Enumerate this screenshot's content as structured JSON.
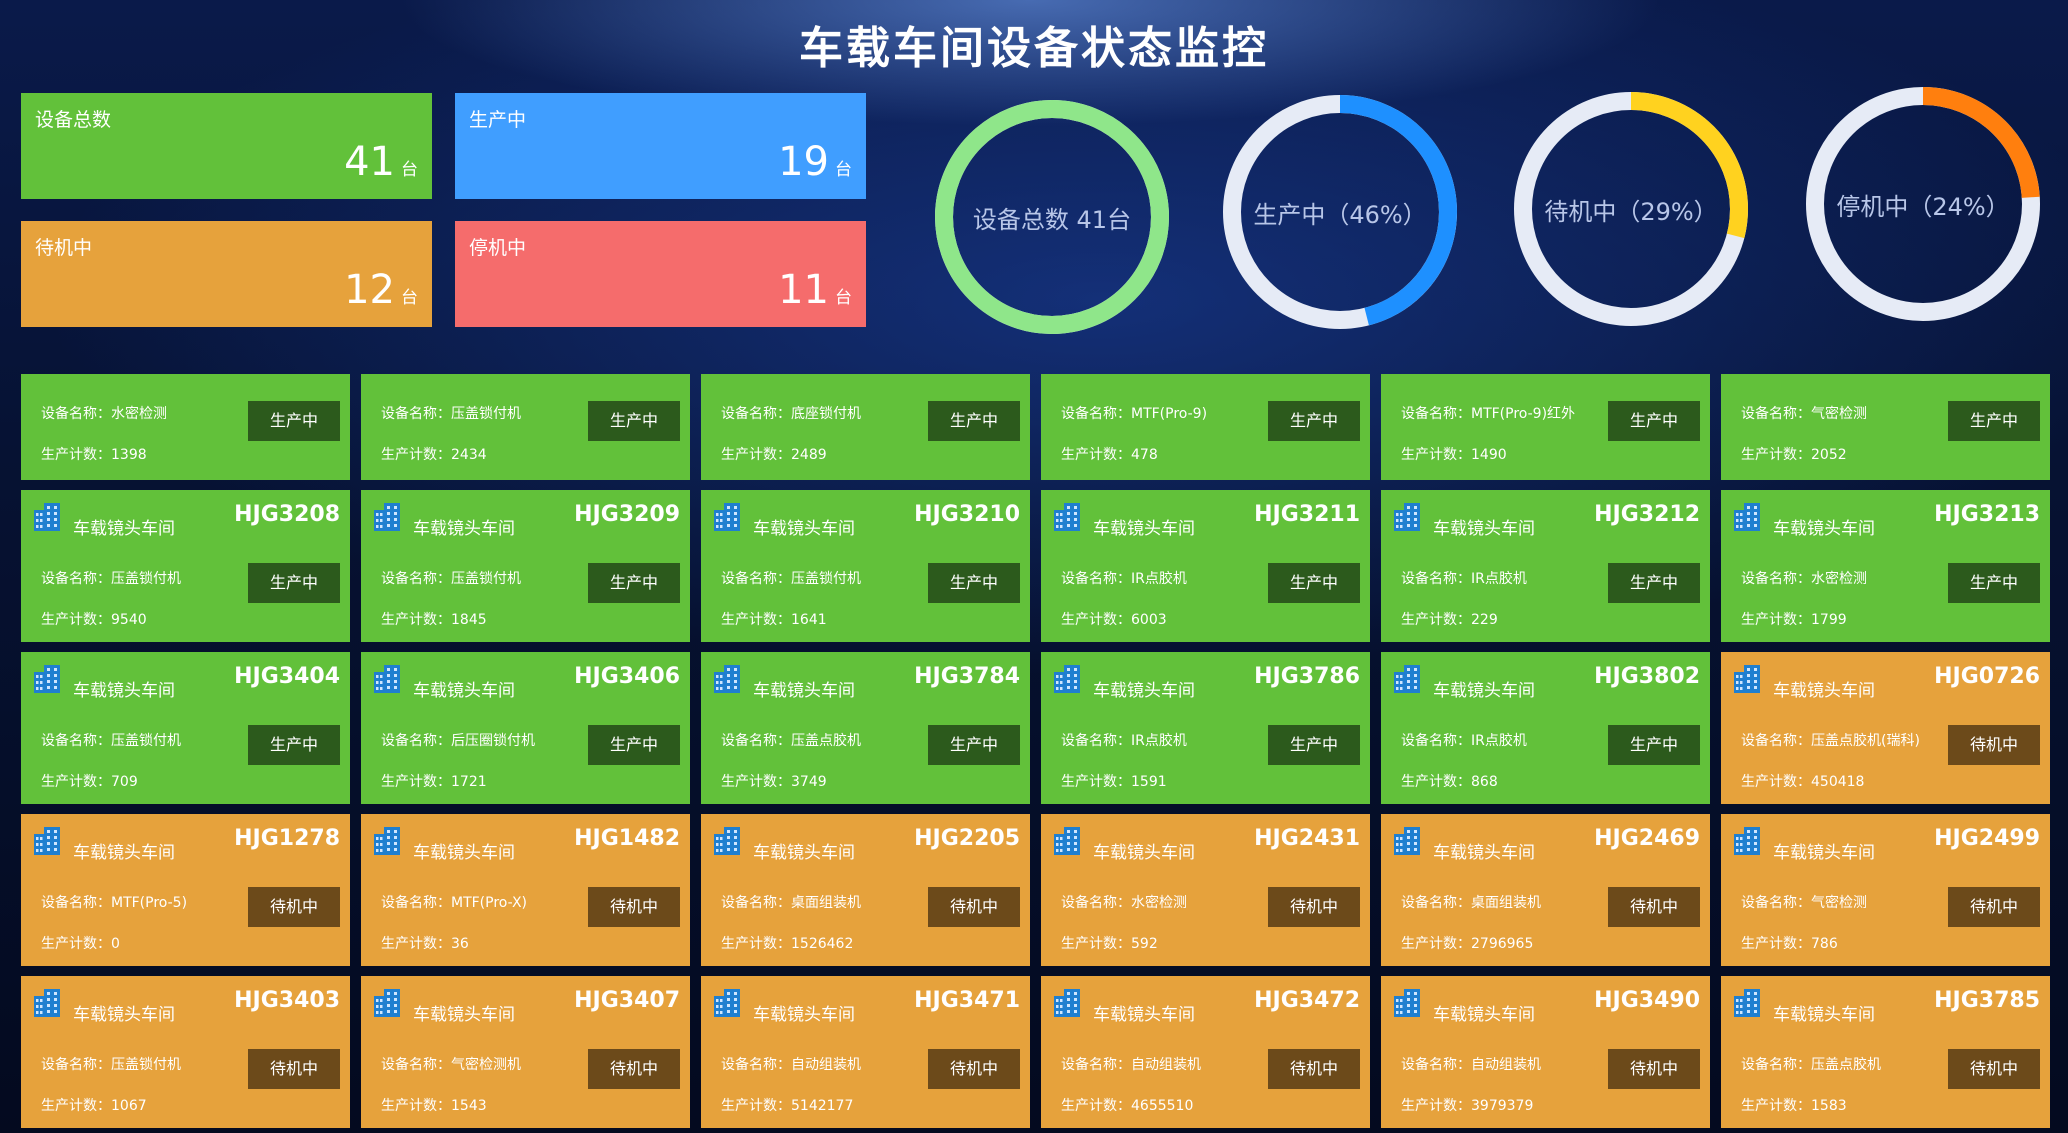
{
  "title": "车载车间设备状态监控",
  "colors": {
    "production": "#62c13a",
    "standby": "#e6a23c",
    "stopped": "#f56c6c",
    "total": "#409eff"
  },
  "stats": [
    {
      "label": "设备总数",
      "value": "41",
      "unit": "台",
      "color": "green"
    },
    {
      "label": "生产中",
      "value": "19",
      "unit": "台",
      "color": "blue"
    },
    {
      "label": "待机中",
      "value": "12",
      "unit": "台",
      "color": "orange"
    },
    {
      "label": "停机中",
      "value": "11",
      "unit": "台",
      "color": "red"
    }
  ],
  "rings": [
    {
      "text": "设备总数 41台",
      "fraction": 1.0,
      "color": "#8fe68a"
    },
    {
      "text": "生产中（46%）",
      "fraction": 0.46,
      "color": "#1e90ff"
    },
    {
      "text": "待机中（29%）",
      "fraction": 0.29,
      "color": "#ffd21f"
    },
    {
      "text": "停机中（24%）",
      "fraction": 0.24,
      "color": "#ff7f0e"
    }
  ],
  "labels": {
    "device_name": "设备名称：",
    "count": "生产计数："
  },
  "cards": [
    {
      "workshop": "",
      "code": "",
      "name": "水密检测",
      "count": "1398",
      "status": "生产中",
      "color": "green"
    },
    {
      "workshop": "",
      "code": "",
      "name": "压盖锁付机",
      "count": "2434",
      "status": "生产中",
      "color": "green"
    },
    {
      "workshop": "",
      "code": "",
      "name": "底座锁付机",
      "count": "2489",
      "status": "生产中",
      "color": "green"
    },
    {
      "workshop": "",
      "code": "",
      "name": "MTF(Pro-9)",
      "count": "478",
      "status": "生产中",
      "color": "green"
    },
    {
      "workshop": "",
      "code": "",
      "name": "MTF(Pro-9)红外",
      "count": "1490",
      "status": "生产中",
      "color": "green"
    },
    {
      "workshop": "",
      "code": "",
      "name": "气密检测",
      "count": "2052",
      "status": "生产中",
      "color": "green"
    },
    {
      "workshop": "车载镜头车间",
      "code": "HJG3208",
      "name": "压盖锁付机",
      "count": "9540",
      "status": "生产中",
      "color": "green"
    },
    {
      "workshop": "车载镜头车间",
      "code": "HJG3209",
      "name": "压盖锁付机",
      "count": "1845",
      "status": "生产中",
      "color": "green"
    },
    {
      "workshop": "车载镜头车间",
      "code": "HJG3210",
      "name": "压盖锁付机",
      "count": "1641",
      "status": "生产中",
      "color": "green"
    },
    {
      "workshop": "车载镜头车间",
      "code": "HJG3211",
      "name": "IR点胶机",
      "count": "6003",
      "status": "生产中",
      "color": "green"
    },
    {
      "workshop": "车载镜头车间",
      "code": "HJG3212",
      "name": "IR点胶机",
      "count": "229",
      "status": "生产中",
      "color": "green"
    },
    {
      "workshop": "车载镜头车间",
      "code": "HJG3213",
      "name": "水密检测",
      "count": "1799",
      "status": "生产中",
      "color": "green"
    },
    {
      "workshop": "车载镜头车间",
      "code": "HJG3404",
      "name": "压盖锁付机",
      "count": "709",
      "status": "生产中",
      "color": "green"
    },
    {
      "workshop": "车载镜头车间",
      "code": "HJG3406",
      "name": "后压圈锁付机",
      "count": "1721",
      "status": "生产中",
      "color": "green"
    },
    {
      "workshop": "车载镜头车间",
      "code": "HJG3784",
      "name": "压盖点胶机",
      "count": "3749",
      "status": "生产中",
      "color": "green"
    },
    {
      "workshop": "车载镜头车间",
      "code": "HJG3786",
      "name": "IR点胶机",
      "count": "1591",
      "status": "生产中",
      "color": "green"
    },
    {
      "workshop": "车载镜头车间",
      "code": "HJG3802",
      "name": "IR点胶机",
      "count": "868",
      "status": "生产中",
      "color": "green"
    },
    {
      "workshop": "车载镜头车间",
      "code": "HJG0726",
      "name": "压盖点胶机(瑞科)",
      "count": "450418",
      "status": "待机中",
      "color": "orange"
    },
    {
      "workshop": "车载镜头车间",
      "code": "HJG1278",
      "name": "MTF(Pro-5)",
      "count": "0",
      "status": "待机中",
      "color": "orange"
    },
    {
      "workshop": "车载镜头车间",
      "code": "HJG1482",
      "name": "MTF(Pro-X)",
      "count": "36",
      "status": "待机中",
      "color": "orange"
    },
    {
      "workshop": "车载镜头车间",
      "code": "HJG2205",
      "name": "桌面组装机",
      "count": "1526462",
      "status": "待机中",
      "color": "orange"
    },
    {
      "workshop": "车载镜头车间",
      "code": "HJG2431",
      "name": "水密检测",
      "count": "592",
      "status": "待机中",
      "color": "orange"
    },
    {
      "workshop": "车载镜头车间",
      "code": "HJG2469",
      "name": "桌面组装机",
      "count": "2796965",
      "status": "待机中",
      "color": "orange"
    },
    {
      "workshop": "车载镜头车间",
      "code": "HJG2499",
      "name": "气密检测",
      "count": "786",
      "status": "待机中",
      "color": "orange"
    },
    {
      "workshop": "车载镜头车间",
      "code": "HJG3403",
      "name": "压盖锁付机",
      "count": "1067",
      "status": "待机中",
      "color": "orange"
    },
    {
      "workshop": "车载镜头车间",
      "code": "HJG3407",
      "name": "气密检测机",
      "count": "1543",
      "status": "待机中",
      "color": "orange"
    },
    {
      "workshop": "车载镜头车间",
      "code": "HJG3471",
      "name": "自动组装机",
      "count": "5142177",
      "status": "待机中",
      "color": "orange"
    },
    {
      "workshop": "车载镜头车间",
      "code": "HJG3472",
      "name": "自动组装机",
      "count": "4655510",
      "status": "待机中",
      "color": "orange"
    },
    {
      "workshop": "车载镜头车间",
      "code": "HJG3490",
      "name": "自动组装机",
      "count": "3979379",
      "status": "待机中",
      "color": "orange"
    },
    {
      "workshop": "车载镜头车间",
      "code": "HJG3785",
      "name": "压盖点胶机",
      "count": "1583",
      "status": "待机中",
      "color": "orange"
    }
  ]
}
